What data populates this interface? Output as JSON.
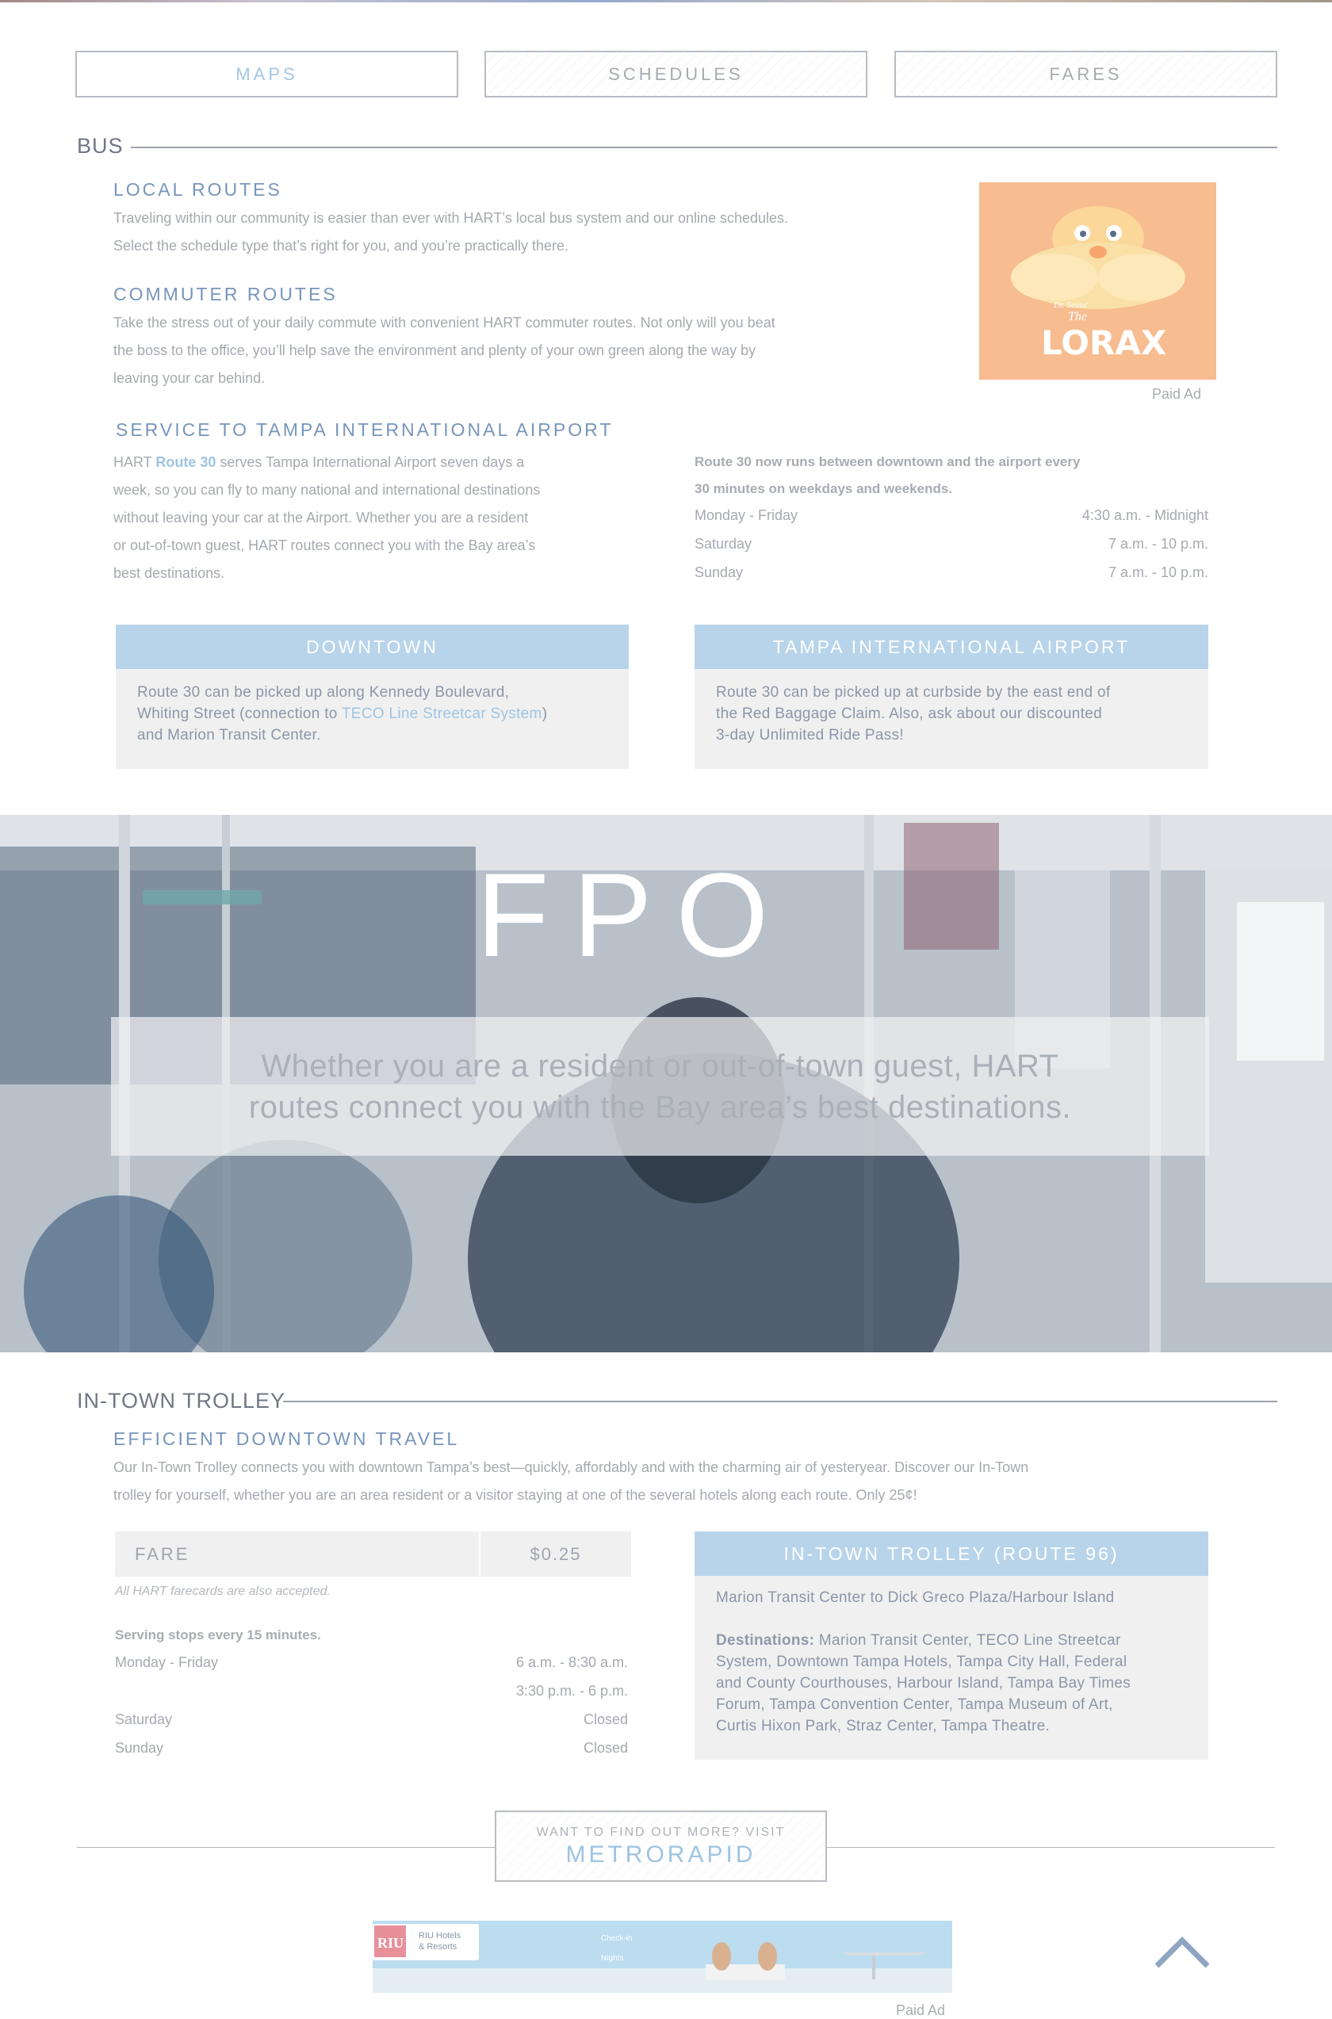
{
  "tabs": [
    {
      "label": "MAPS",
      "active": true
    },
    {
      "label": "SCHEDULES",
      "active": false
    },
    {
      "label": "FARES",
      "active": false
    }
  ],
  "bus": {
    "title": "BUS",
    "local": {
      "heading": "LOCAL ROUTES",
      "line1": "Traveling within our community is easier than ever with HART’s local bus system and our online schedules.",
      "line2": "Select the schedule type that’s right for you, and you’re practically there."
    },
    "commuter": {
      "heading": "COMMUTER ROUTES",
      "line1": "Take the stress out of your daily commute with convenient HART commuter routes. Not only will you beat",
      "line2": "the boss to the office, you’ll help save the environment and plenty of your own green along the way by",
      "line3": "leaving your car behind."
    },
    "ad_label": "Paid Ad",
    "ad_brand": "Dr. Seuss'",
    "ad_title_the": "The",
    "ad_title_main": "LORAX",
    "airport": {
      "heading": "SERVICE TO TAMPA INTERNATIONAL AIRPORT",
      "prefix": "HART ",
      "route_link": "Route 30",
      "line1_rest": " serves Tampa International Airport seven days a",
      "line2": "week, so you can fly to many national and international destinations",
      "line3": "without leaving your car at the Airport. Whether you are a resident",
      "line4": "or out-of-town guest, HART routes connect you with the Bay area’s",
      "line5": "best destinations.",
      "note_line1": "Route 30 now runs between downtown and the airport every",
      "note_line2": "30 minutes on weekdays and weekends.",
      "schedule": [
        {
          "day": "Monday - Friday",
          "time": "4:30 a.m. - Midnight"
        },
        {
          "day": "Saturday",
          "time": "7 a.m. - 10 p.m."
        },
        {
          "day": "Sunday",
          "time": "7 a.m. - 10 p.m."
        }
      ]
    },
    "cards": {
      "downtown": {
        "title": "DOWNTOWN",
        "t1": "Route 30 can be picked up along Kennedy Boulevard,",
        "t2": "Whiting Street (connection to ",
        "link": "TECO Line Streetcar System",
        "t3": ")",
        "t4": "and Marion Transit Center."
      },
      "airport": {
        "title": "TAMPA INTERNATIONAL AIRPORT",
        "t1": "Route 30 can be picked up at curbside by the east end of",
        "t2": "the Red Baggage Claim. Also, ask about our discounted",
        "t3": "3-day Unlimited Ride Pass!"
      }
    }
  },
  "hero": {
    "fpo": "FPO",
    "quote_line1": "Whether you are a resident or out-of-town guest, HART",
    "quote_line2": "routes connect you with the Bay area’s best destinations."
  },
  "trolley": {
    "title": "IN-TOWN TROLLEY",
    "heading": "EFFICIENT DOWNTOWN TRAVEL",
    "line1": "Our In-Town Trolley connects you with downtown Tampa’s best—quickly, affordably and with the charming air of yesteryear. Discover our In-Town",
    "line2": "trolley for yourself, whether you are an area resident or a visitor staying at one of the several hotels along each route. Only 25¢!",
    "fare_label": "FARE",
    "fare_value": "$0.25",
    "fare_note": "All HART farecards are also accepted.",
    "serving": "Serving stops every 15 minutes.",
    "schedule": [
      {
        "day": "Monday - Friday",
        "time": "6 a.m. - 8:30 a.m."
      },
      {
        "day": "",
        "time": "3:30 p.m. - 6 p.m."
      },
      {
        "day": "Saturday",
        "time": "Closed"
      },
      {
        "day": "Sunday",
        "time": "Closed"
      }
    ],
    "card": {
      "title": "IN-TOWN TROLLEY (ROUTE 96)",
      "route": "Marion Transit Center to Dick Greco Plaza/Harbour Island",
      "dest_label": "Destinations:",
      "d1": " Marion Transit Center, TECO Line Streetcar",
      "d2": "System, Downtown Tampa Hotels, Tampa City Hall, Federal",
      "d3": "and County Courthouses, Harbour Island, Tampa Bay Times",
      "d4": "Forum, Tampa Convention Center, Tampa Museum of Art,",
      "d5": "Curtis Hixon Park, Straz Center, Tampa Theatre."
    }
  },
  "metrorapid": {
    "small": "WANT TO FIND OUT MORE? VISIT",
    "big": "METRORAPID"
  },
  "bottom_ad": {
    "logo": "RIU",
    "brand_line1": "RIU Hotels",
    "brand_line2": "& Resorts",
    "text1": "Check-in",
    "text2": "Nights",
    "label": "Paid Ad"
  },
  "icons": {
    "back_to_top": "chevron-up-icon"
  },
  "colors": {
    "accent_blue": "#9ec4e2",
    "heading_blue": "#7795ba",
    "card_head": "#b8d4ea",
    "arrow": "#8ea6c2"
  }
}
